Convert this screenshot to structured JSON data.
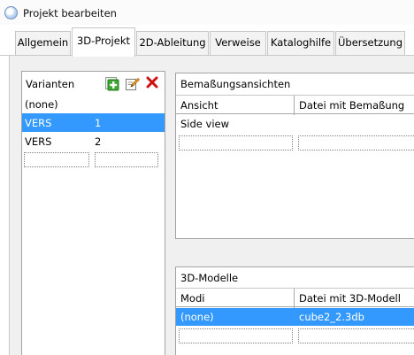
{
  "window": {
    "title": "Projekt bearbeiten"
  },
  "tabs": [
    {
      "label": "Allgemein",
      "active": false
    },
    {
      "label": "3D-Projekt",
      "active": true
    },
    {
      "label": "2D-Ableitung",
      "active": false
    },
    {
      "label": "Verweise",
      "active": false
    },
    {
      "label": "Kataloghilfe",
      "active": false
    },
    {
      "label": "Übersetzung",
      "active": false
    }
  ],
  "variants": {
    "title": "Varianten",
    "icons": [
      "add-icon",
      "edit-icon",
      "delete-icon"
    ],
    "rows": [
      {
        "name": "(none)",
        "num": ""
      },
      {
        "name": "VERS",
        "num": "1",
        "selected": true
      },
      {
        "name": "VERS",
        "num": "2"
      }
    ]
  },
  "dimension_views": {
    "title": "Bemaßungsansichten",
    "columns": [
      "Ansicht",
      "Datei mit Bemaßung"
    ],
    "rows": [
      {
        "view": "Side view",
        "file": ""
      }
    ]
  },
  "models": {
    "title": "3D-Modelle",
    "columns": [
      "Modi",
      "Datei mit 3D-Modell"
    ],
    "rows": [
      {
        "mode": "(none)",
        "file": "cube2_2.3db",
        "selected": true
      }
    ]
  },
  "colors": {
    "selection": "#3399ff",
    "panel": "#f0f0f0"
  }
}
